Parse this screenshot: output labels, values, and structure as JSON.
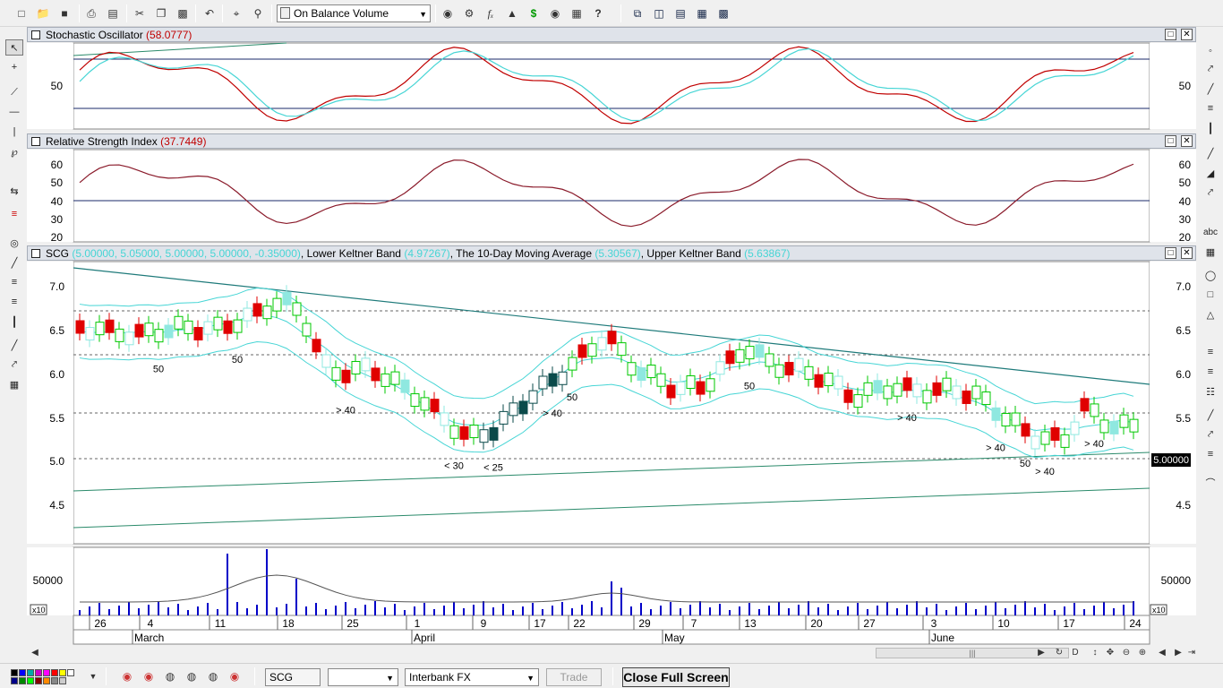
{
  "toolbar": {
    "study_select": "On Balance Volume",
    "icons": [
      "new-icon",
      "open-icon",
      "save-icon",
      "print-icon",
      "print-preview-icon",
      "cut-icon",
      "copy-icon",
      "paste-icon",
      "undo-icon",
      "crosshair-icon",
      "zoom-icon",
      "lock-icon",
      "security-icon",
      "formula-icon",
      "indicator-icon",
      "dollar-icon",
      "binoculars-icon",
      "explorer-icon",
      "help-icon",
      "window-cascade-icon",
      "tile-vertical-icon",
      "tile-horizontal-icon",
      "tile-grid-icon",
      "layout-icon"
    ]
  },
  "panes": {
    "stochastic": {
      "name": "Stochastic Oscillator",
      "value": "(58.0777)",
      "ticks": [
        "50"
      ]
    },
    "rsi": {
      "name": "Relative Strength Index",
      "value": "(37.7449)",
      "ticks": [
        "60",
        "50",
        "40",
        "30",
        "20"
      ]
    },
    "price": {
      "symbol": "SCG",
      "ohlc": "(5.00000, 5.05000, 5.00000, 5.00000, -0.35000)",
      "lower_label": "Lower Keltner Band",
      "lower_value": "(4.97267)",
      "ma_label": "The 10-Day Moving Average",
      "ma_value": "(5.30567)",
      "upper_label": "Upper Keltner Band",
      "upper_value": "(5.63867)",
      "ticks": [
        "7.0",
        "6.5",
        "6.0",
        "5.5",
        "5.0",
        "4.5"
      ],
      "current_price": "5.00000",
      "annotations": [
        "50",
        "50",
        "> 40",
        "< 30",
        "< 25",
        "> 40",
        "50",
        "50",
        "> 40",
        "50",
        "> 40",
        "> 40",
        "> 40"
      ]
    },
    "volume": {
      "ticks": [
        "50000"
      ],
      "multiplier": "x10"
    }
  },
  "xaxis": {
    "days": [
      "26",
      "4",
      "11",
      "18",
      "25",
      "1",
      "9",
      "17",
      "22",
      "29",
      "7",
      "13",
      "20",
      "27",
      "3",
      "10",
      "17",
      "24"
    ],
    "months": [
      "March",
      "April",
      "May",
      "June"
    ]
  },
  "bottom": {
    "symbol": "SCG",
    "empty_select": "",
    "exchange": "Interbank FX",
    "trade": "Trade",
    "close_full_screen": "Close Full Screen"
  },
  "colors": {
    "up_candle": "#00c800",
    "down_candle": "#e00000",
    "stoch_k": "#c00000",
    "stoch_d": "#46d5d5",
    "keltner": "#46d5d5",
    "trendline": "#1e7a7a",
    "volume_bar": "#0000c8",
    "pane_title_bg": "#dfe3ea"
  }
}
